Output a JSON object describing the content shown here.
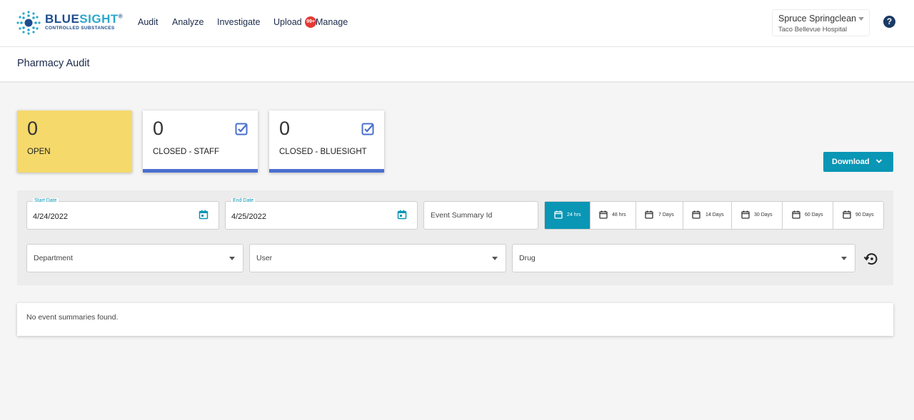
{
  "brand": {
    "name_part1": "BLUE",
    "name_part2": "SIGHT",
    "registered": "®",
    "tagline": "CONTROLLED SUBSTANCES",
    "colors": {
      "primary": "#1d4d8f",
      "accent": "#2ba7cc"
    }
  },
  "nav": {
    "items": [
      {
        "label": "Audit"
      },
      {
        "label": "Analyze"
      },
      {
        "label": "Investigate"
      },
      {
        "label": "Upload"
      },
      {
        "label": "Manage"
      }
    ],
    "badge": "99+"
  },
  "user": {
    "name": "Spruce Springclean",
    "hospital": "Taco Bellevue Hospital"
  },
  "help_icon": "?",
  "page": {
    "title": "Pharmacy Audit"
  },
  "cards": [
    {
      "count": "0",
      "label": "OPEN",
      "color": "#f5d96b"
    },
    {
      "count": "0",
      "label": "CLOSED - STAFF",
      "icon": "checkbox-checked-icon"
    },
    {
      "count": "0",
      "label": "CLOSED - BLUESIGHT",
      "icon": "checkbox-checked-icon"
    }
  ],
  "download": {
    "label": "Download"
  },
  "filters": {
    "start_date": {
      "label": "Start Date",
      "value": "4/24/2022"
    },
    "end_date": {
      "label": "End Date",
      "value": "4/25/2022"
    },
    "event_summary_placeholder": "Event Summary Id",
    "ranges": [
      {
        "label": "24 hrs",
        "active": true
      },
      {
        "label": "48 hrs",
        "active": false
      },
      {
        "label": "7 Days",
        "active": false
      },
      {
        "label": "14 Days",
        "active": false
      },
      {
        "label": "30 Days",
        "active": false
      },
      {
        "label": "60 Days",
        "active": false
      },
      {
        "label": "90 Days",
        "active": false
      }
    ],
    "department": "Department",
    "user": "User",
    "drug": "Drug"
  },
  "results": {
    "empty_message": "No event summaries found."
  },
  "accent_color": "#0a96b5"
}
